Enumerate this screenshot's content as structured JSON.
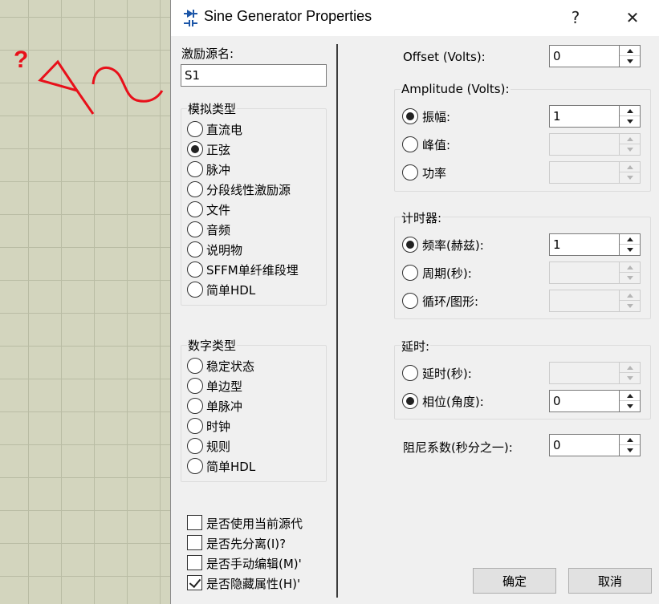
{
  "window": {
    "title": "Sine Generator Properties",
    "help_label": "?",
    "close_label": "✕"
  },
  "background": {
    "question_mark": "?",
    "grid_color": "#d3d5be",
    "symbol_color": "#e8101a"
  },
  "source_name": {
    "label": "激励源名:",
    "value": "S1"
  },
  "analog": {
    "title": "模拟类型",
    "options": [
      {
        "label": "直流电",
        "checked": false
      },
      {
        "label": "正弦",
        "checked": true
      },
      {
        "label": "脉冲",
        "checked": false
      },
      {
        "label": "分段线性激励源",
        "checked": false
      },
      {
        "label": "文件",
        "checked": false
      },
      {
        "label": "音频",
        "checked": false
      },
      {
        "label": "说明物",
        "checked": false
      },
      {
        "label": "SFFM单纤维段埋",
        "checked": false
      },
      {
        "label": "简单HDL",
        "checked": false
      }
    ]
  },
  "digital": {
    "title": "数字类型",
    "options": [
      {
        "label": "稳定状态",
        "checked": false
      },
      {
        "label": "单边型",
        "checked": false
      },
      {
        "label": "单脉冲",
        "checked": false
      },
      {
        "label": "时钟",
        "checked": false
      },
      {
        "label": "规则",
        "checked": false
      },
      {
        "label": "简单HDL",
        "checked": false
      }
    ]
  },
  "checks": [
    {
      "label": "是否使用当前源代",
      "checked": false
    },
    {
      "label": "是否先分离(I)?",
      "checked": false
    },
    {
      "label": "是否手动编辑(M)'",
      "checked": false
    },
    {
      "label": "是否隐藏属性(H)'",
      "checked": true
    }
  ],
  "offset": {
    "label": "Offset (Volts):",
    "value": "0"
  },
  "amplitude": {
    "title": "Amplitude (Volts):",
    "rows": [
      {
        "label": "振幅:",
        "checked": true,
        "value": "1"
      },
      {
        "label": "峰值:",
        "checked": false,
        "value": ""
      },
      {
        "label": "功率",
        "checked": false,
        "value": ""
      }
    ]
  },
  "timing": {
    "title": "计时器:",
    "rows": [
      {
        "label": "频率(赫兹):",
        "checked": true,
        "value": "1"
      },
      {
        "label": "周期(秒):",
        "checked": false,
        "value": ""
      },
      {
        "label": "循环/图形:",
        "checked": false,
        "value": ""
      }
    ]
  },
  "delay": {
    "title": "延时:",
    "rows": [
      {
        "label": "延时(秒):",
        "checked": false,
        "value": ""
      },
      {
        "label": "相位(角度):",
        "checked": true,
        "value": "0"
      }
    ]
  },
  "damping": {
    "label": "阻尼系数(秒分之一):",
    "value": "0"
  },
  "buttons": {
    "ok": "确定",
    "cancel": "取消"
  }
}
